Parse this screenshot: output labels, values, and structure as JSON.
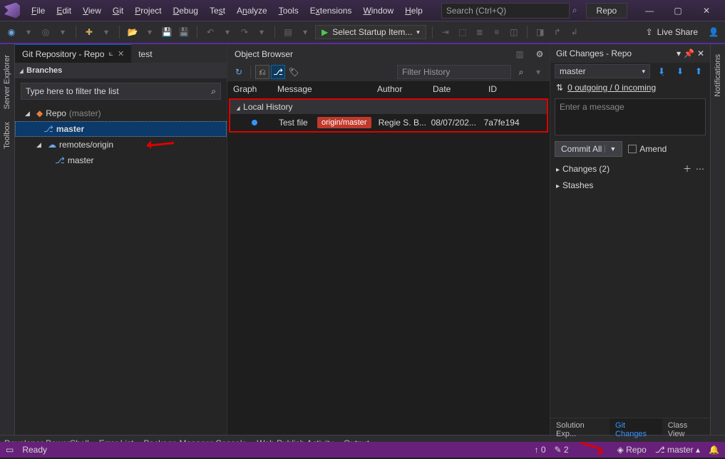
{
  "menu": {
    "file": "File",
    "edit": "Edit",
    "view": "View",
    "git": "Git",
    "project": "Project",
    "debug": "Debug",
    "test": "Test",
    "analyze": "Analyze",
    "tools": "Tools",
    "extensions": "Extensions",
    "window": "Window",
    "help": "Help"
  },
  "titlebar": {
    "search_placeholder": "Search (Ctrl+Q)",
    "repo_button": "Repo"
  },
  "toolbar": {
    "startup": "Select Startup Item...",
    "liveshare": "Live Share"
  },
  "leftrail": {
    "server_explorer": "Server Explorer",
    "toolbox": "Toolbox"
  },
  "rightrail": {
    "notifications": "Notifications"
  },
  "repo_panel": {
    "tab_title": "Git Repository - Repo",
    "other_tab": "test",
    "other_tab2": "Object Browser",
    "branches_hdr": "Branches",
    "filter_placeholder": "Type here to filter the list",
    "root_name": "Repo",
    "root_suffix": "(master)",
    "branch_master": "master",
    "remotes": "remotes/origin",
    "remote_master": "master"
  },
  "history": {
    "filter_placeholder": "Filter History",
    "cols": {
      "graph": "Graph",
      "message": "Message",
      "author": "Author",
      "date": "Date",
      "id": "ID"
    },
    "local_history": "Local History",
    "commit": {
      "message": "Test file",
      "origin": "origin/master",
      "author": "Regie S. B...",
      "date": "08/07/202...",
      "id": "7a7fe194"
    }
  },
  "changes": {
    "title": "Git Changes - Repo",
    "branch": "master",
    "sync": "0 outgoing / 0 incoming",
    "msg_placeholder": "Enter a message",
    "commit_all": "Commit All",
    "amend": "Amend",
    "changes_hdr": "Changes (2)",
    "stashes_hdr": "Stashes",
    "tabs": {
      "solexp": "Solution Exp...",
      "gitchanges": "Git Changes",
      "classview": "Class View"
    }
  },
  "bottom_tabs": {
    "devps": "Developer PowerShell",
    "errlist": "Error List",
    "pkgmgr": "Package Manager Console",
    "webpub": "Web Publish Activity",
    "output": "Output"
  },
  "status": {
    "ready": "Ready",
    "push_count": "0",
    "pencil_count": "2",
    "repo": "Repo",
    "branch": "master"
  }
}
